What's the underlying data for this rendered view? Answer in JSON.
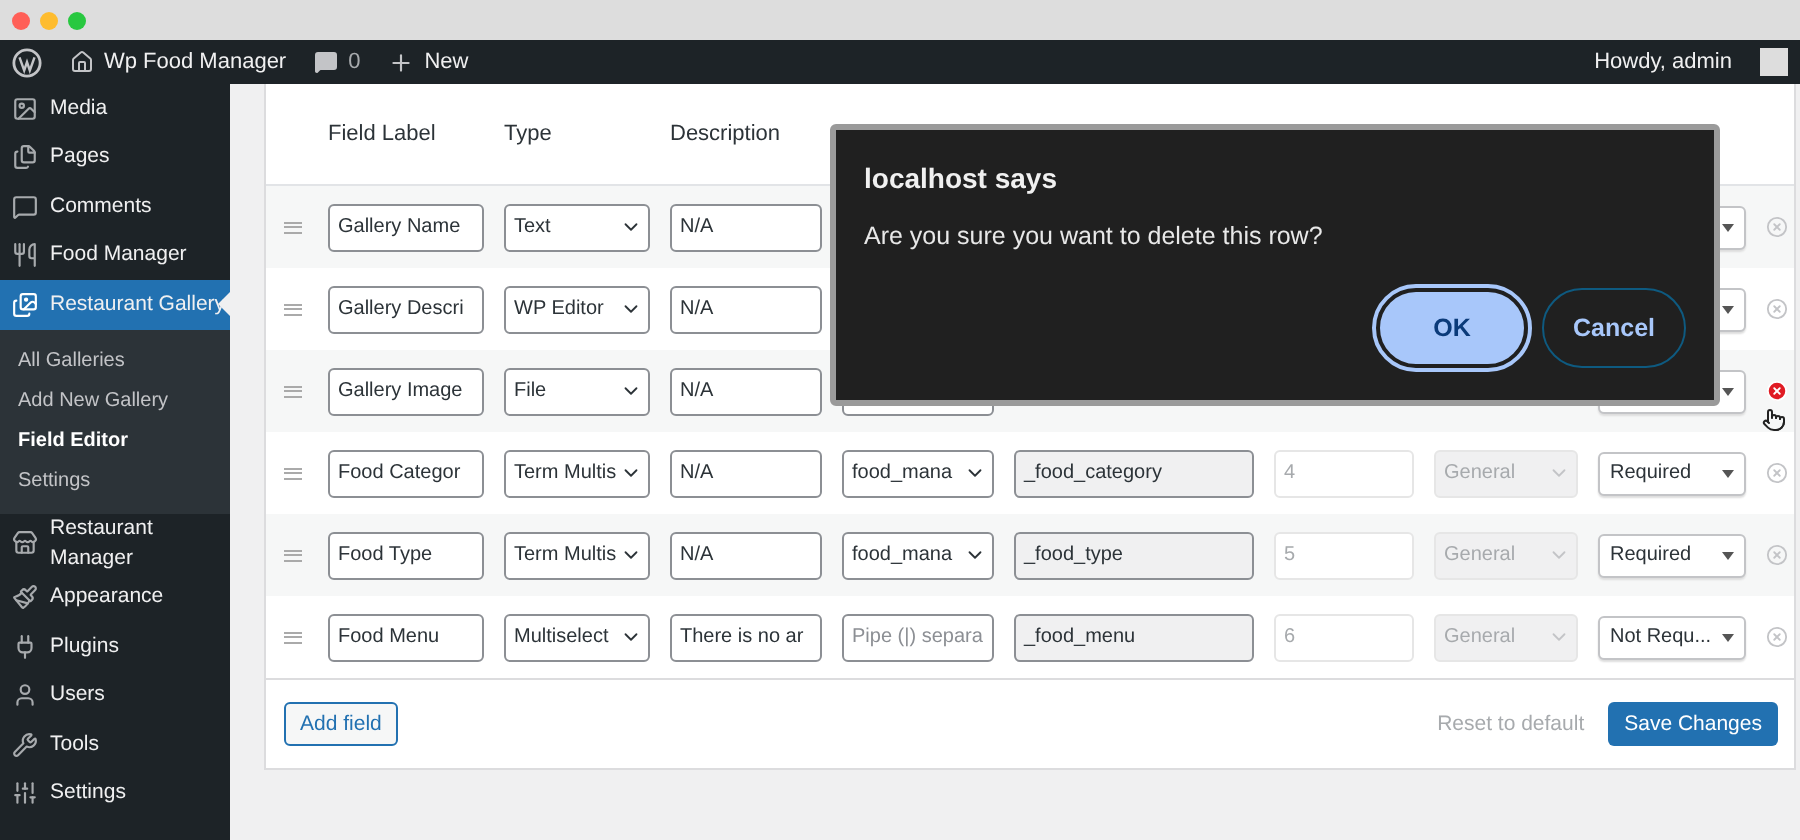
{
  "admin_bar": {
    "site": "Wp Food Manager",
    "comments": "0",
    "new": "New",
    "greeting": "Howdy, admin"
  },
  "sidebar": {
    "items": [
      {
        "label": "Media",
        "selected": false
      },
      {
        "label": "Pages",
        "selected": false
      },
      {
        "label": "Comments",
        "selected": false
      },
      {
        "label": "Food Manager",
        "selected": false
      },
      {
        "label": "Restaurant Gallery",
        "selected": true,
        "children": [
          {
            "label": "All Galleries",
            "selected": false
          },
          {
            "label": "Add New Gallery",
            "selected": false
          },
          {
            "label": "Field Editor",
            "selected": true
          },
          {
            "label": "Settings",
            "selected": false
          }
        ]
      },
      {
        "label": "Restaurant Manager",
        "selected": false
      },
      {
        "label": "Appearance",
        "selected": false
      },
      {
        "label": "Plugins",
        "selected": false
      },
      {
        "label": "Users",
        "selected": false
      },
      {
        "label": "Tools",
        "selected": false
      },
      {
        "label": "Settings",
        "selected": false
      }
    ]
  },
  "table": {
    "columns": [
      "Field Label",
      "Type",
      "Description"
    ],
    "rows": [
      {
        "label": "Gallery Name",
        "type": "Text",
        "description": "N/A",
        "delete_hover": false
      },
      {
        "label": "Gallery Descri",
        "type": "WP Editor",
        "description": "N/A",
        "delete_hover": false
      },
      {
        "label": "Gallery Image",
        "type": "File",
        "description": "N/A",
        "delete_hover": true
      },
      {
        "label": "Food Categor",
        "type": "Term Multis",
        "description": "N/A",
        "placeholder": {
          "kind": "select",
          "text": "food_mana"
        },
        "meta_key": "_food_category",
        "priority": "4",
        "tab": "General",
        "required": "Required",
        "delete_hover": false
      },
      {
        "label": "Food Type",
        "type": "Term Multis",
        "description": "N/A",
        "placeholder": {
          "kind": "select",
          "text": "food_mana"
        },
        "meta_key": "_food_type",
        "priority": "5",
        "tab": "General",
        "required": "Required",
        "delete_hover": false
      },
      {
        "label": "Food Menu",
        "type": "Multiselect",
        "description": "There is no ar",
        "placeholder": {
          "kind": "input",
          "text": "Pipe (|) separa"
        },
        "meta_key": "_food_menu",
        "priority": "6",
        "tab": "General",
        "required": "Not Requ...",
        "delete_hover": false
      }
    ]
  },
  "footer": {
    "add": "Add field",
    "reset": "Reset to default",
    "save": "Save Changes"
  },
  "dialog": {
    "title": "localhost says",
    "message": "Are you sure you want to delete this row?",
    "ok": "OK",
    "cancel": "Cancel"
  }
}
